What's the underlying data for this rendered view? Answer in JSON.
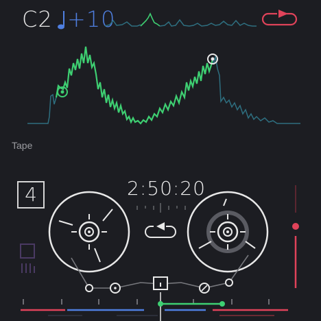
{
  "header": {
    "note": "C2",
    "tune_value": "+10",
    "tune_icon": "music-note-icon",
    "loop_icon": "loop-arrow-icon"
  },
  "section": {
    "label": "Tape"
  },
  "tape": {
    "track_number": "4",
    "time": "2:50:20",
    "reverse_icon": "reverse-loop-icon"
  },
  "colors": {
    "background": "#1c1d22",
    "waveform": "#2e6f80",
    "selection": "#3ecf72",
    "tune": "#4f7fe0",
    "loop": "#e0435a",
    "reel": "#e8e8e8",
    "track_red": "#e0435a"
  },
  "controls": {
    "volume_fader_level": 0.72
  }
}
